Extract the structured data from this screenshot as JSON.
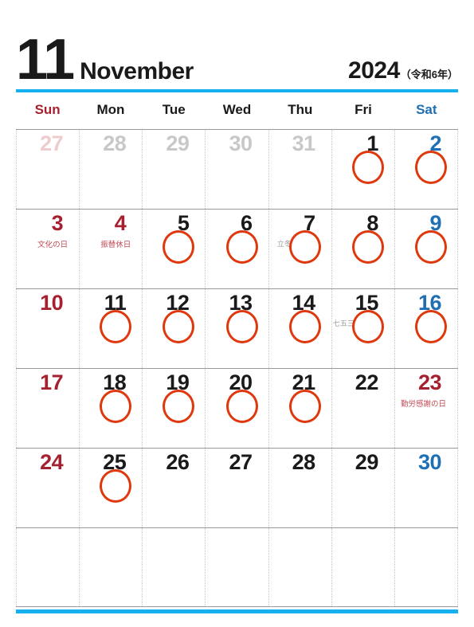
{
  "header": {
    "month_number": "11",
    "month_name": "November",
    "year": "2024",
    "era": "（令和6年）"
  },
  "colors": {
    "accent_bar": "#17b0ee",
    "sunday": "#a52130",
    "saturday": "#1f6fb5",
    "mark": "#e0380d",
    "holiday_text": "#c24a55",
    "season_text": "#9a9a9a",
    "grid_line": "#9a9a9a",
    "outside_day": "#c8c8c8"
  },
  "weekdays": [
    {
      "label": "Sun",
      "kind": "sun"
    },
    {
      "label": "Mon",
      "kind": "wk"
    },
    {
      "label": "Tue",
      "kind": "wk"
    },
    {
      "label": "Wed",
      "kind": "wk"
    },
    {
      "label": "Thu",
      "kind": "wk"
    },
    {
      "label": "Fri",
      "kind": "wk"
    },
    {
      "label": "Sat",
      "kind": "sat"
    }
  ],
  "weeks": [
    [
      {
        "day": "27",
        "outside": true,
        "kind": "sun",
        "marked": false,
        "holiday": "",
        "season": ""
      },
      {
        "day": "28",
        "outside": true,
        "kind": "wk",
        "marked": false,
        "holiday": "",
        "season": ""
      },
      {
        "day": "29",
        "outside": true,
        "kind": "wk",
        "marked": false,
        "holiday": "",
        "season": ""
      },
      {
        "day": "30",
        "outside": true,
        "kind": "wk",
        "marked": false,
        "holiday": "",
        "season": ""
      },
      {
        "day": "31",
        "outside": true,
        "kind": "wk",
        "marked": false,
        "holiday": "",
        "season": ""
      },
      {
        "day": "1",
        "outside": false,
        "kind": "wk",
        "marked": true,
        "holiday": "",
        "season": ""
      },
      {
        "day": "2",
        "outside": false,
        "kind": "sat",
        "marked": true,
        "holiday": "",
        "season": ""
      }
    ],
    [
      {
        "day": "3",
        "outside": false,
        "kind": "sun",
        "marked": false,
        "holiday": "文化の日",
        "season": ""
      },
      {
        "day": "4",
        "outside": false,
        "kind": "hol",
        "marked": false,
        "holiday": "振替休日",
        "season": ""
      },
      {
        "day": "5",
        "outside": false,
        "kind": "wk",
        "marked": true,
        "holiday": "",
        "season": ""
      },
      {
        "day": "6",
        "outside": false,
        "kind": "wk",
        "marked": true,
        "holiday": "",
        "season": ""
      },
      {
        "day": "7",
        "outside": false,
        "kind": "wk",
        "marked": true,
        "holiday": "",
        "season": "立冬"
      },
      {
        "day": "8",
        "outside": false,
        "kind": "wk",
        "marked": true,
        "holiday": "",
        "season": ""
      },
      {
        "day": "9",
        "outside": false,
        "kind": "sat",
        "marked": true,
        "holiday": "",
        "season": ""
      }
    ],
    [
      {
        "day": "10",
        "outside": false,
        "kind": "sun",
        "marked": false,
        "holiday": "",
        "season": ""
      },
      {
        "day": "11",
        "outside": false,
        "kind": "wk",
        "marked": true,
        "holiday": "",
        "season": ""
      },
      {
        "day": "12",
        "outside": false,
        "kind": "wk",
        "marked": true,
        "holiday": "",
        "season": ""
      },
      {
        "day": "13",
        "outside": false,
        "kind": "wk",
        "marked": true,
        "holiday": "",
        "season": ""
      },
      {
        "day": "14",
        "outside": false,
        "kind": "wk",
        "marked": true,
        "holiday": "",
        "season": ""
      },
      {
        "day": "15",
        "outside": false,
        "kind": "wk",
        "marked": true,
        "holiday": "",
        "season": "七五三"
      },
      {
        "day": "16",
        "outside": false,
        "kind": "sat",
        "marked": true,
        "holiday": "",
        "season": ""
      }
    ],
    [
      {
        "day": "17",
        "outside": false,
        "kind": "sun",
        "marked": false,
        "holiday": "",
        "season": ""
      },
      {
        "day": "18",
        "outside": false,
        "kind": "wk",
        "marked": true,
        "holiday": "",
        "season": ""
      },
      {
        "day": "19",
        "outside": false,
        "kind": "wk",
        "marked": true,
        "holiday": "",
        "season": ""
      },
      {
        "day": "20",
        "outside": false,
        "kind": "wk",
        "marked": true,
        "holiday": "",
        "season": ""
      },
      {
        "day": "21",
        "outside": false,
        "kind": "wk",
        "marked": true,
        "holiday": "",
        "season": ""
      },
      {
        "day": "22",
        "outside": false,
        "kind": "wk",
        "marked": false,
        "holiday": "",
        "season": ""
      },
      {
        "day": "23",
        "outside": false,
        "kind": "hol",
        "marked": false,
        "holiday": "勤労感謝の日",
        "season": ""
      }
    ],
    [
      {
        "day": "24",
        "outside": false,
        "kind": "sun",
        "marked": false,
        "holiday": "",
        "season": ""
      },
      {
        "day": "25",
        "outside": false,
        "kind": "wk",
        "marked": true,
        "holiday": "",
        "season": ""
      },
      {
        "day": "26",
        "outside": false,
        "kind": "wk",
        "marked": false,
        "holiday": "",
        "season": ""
      },
      {
        "day": "27",
        "outside": false,
        "kind": "wk",
        "marked": false,
        "holiday": "",
        "season": ""
      },
      {
        "day": "28",
        "outside": false,
        "kind": "wk",
        "marked": false,
        "holiday": "",
        "season": ""
      },
      {
        "day": "29",
        "outside": false,
        "kind": "wk",
        "marked": false,
        "holiday": "",
        "season": ""
      },
      {
        "day": "30",
        "outside": false,
        "kind": "sat",
        "marked": false,
        "holiday": "",
        "season": ""
      }
    ],
    [
      {
        "day": "",
        "outside": false,
        "kind": "sun",
        "marked": false,
        "holiday": "",
        "season": ""
      },
      {
        "day": "",
        "outside": false,
        "kind": "wk",
        "marked": false,
        "holiday": "",
        "season": ""
      },
      {
        "day": "",
        "outside": false,
        "kind": "wk",
        "marked": false,
        "holiday": "",
        "season": ""
      },
      {
        "day": "",
        "outside": false,
        "kind": "wk",
        "marked": false,
        "holiday": "",
        "season": ""
      },
      {
        "day": "",
        "outside": false,
        "kind": "wk",
        "marked": false,
        "holiday": "",
        "season": ""
      },
      {
        "day": "",
        "outside": false,
        "kind": "wk",
        "marked": false,
        "holiday": "",
        "season": ""
      },
      {
        "day": "",
        "outside": false,
        "kind": "sat",
        "marked": false,
        "holiday": "",
        "season": ""
      }
    ]
  ]
}
